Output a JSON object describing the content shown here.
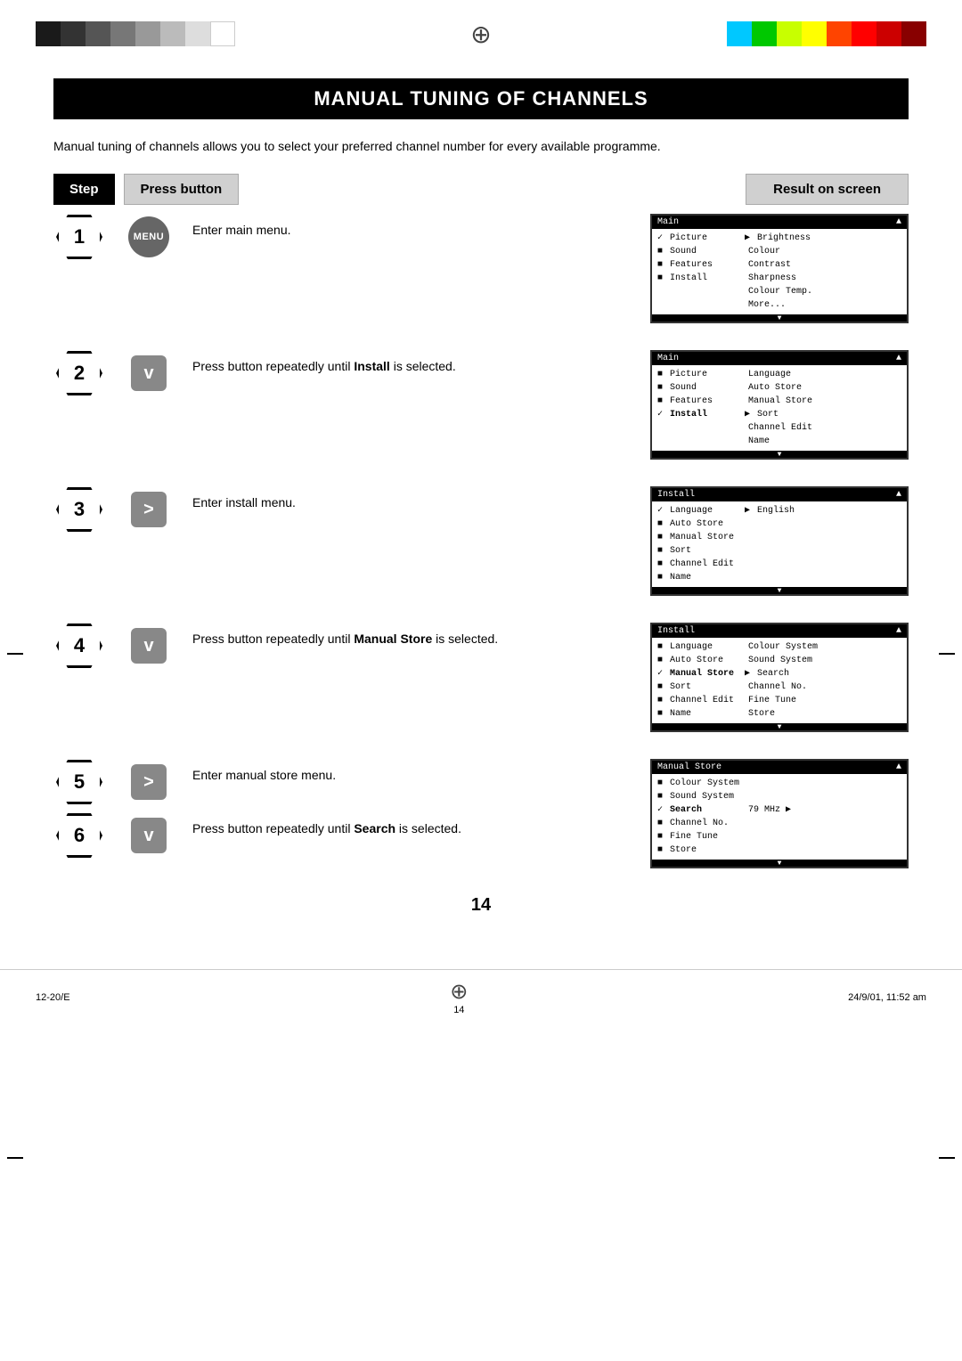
{
  "page": {
    "number": "14",
    "bottom_left": "12-20/E",
    "bottom_center": "14",
    "bottom_right": "24/9/01, 11:52 am"
  },
  "title": "Manual Tuning of Channels",
  "intro": "Manual tuning of channels allows you to select your preferred channel number for every available programme.",
  "header": {
    "step": "Step",
    "press": "Press button",
    "result": "Result on screen"
  },
  "steps": [
    {
      "number": "1",
      "button": "MENU",
      "button_type": "circle",
      "text": "Enter main menu.",
      "bold": "",
      "screen": {
        "title": "Main",
        "has_up": true,
        "lines": [
          {
            "check": true,
            "label": "Picture",
            "arrow": true,
            "value": "Brightness"
          },
          {
            "check": false,
            "label": "Sound",
            "value": "Colour"
          },
          {
            "check": false,
            "label": "Features",
            "value": "Contrast"
          },
          {
            "check": false,
            "label": "Install",
            "value": "Sharpness"
          },
          {
            "check": false,
            "label": "",
            "value": "Colour Temp."
          },
          {
            "check": false,
            "label": "",
            "value": "More..."
          }
        ],
        "has_down": true
      }
    },
    {
      "number": "2",
      "button": "v",
      "button_type": "rect",
      "text": "Press button repeatedly until ",
      "bold": "Install",
      "text2": " is selected.",
      "screen": {
        "title": "Main",
        "has_up": true,
        "lines": [
          {
            "check": false,
            "label": "Picture",
            "arrow": false,
            "value": "Language"
          },
          {
            "check": false,
            "label": "Sound",
            "value": "Auto Store"
          },
          {
            "check": false,
            "label": "Features",
            "value": "Manual Store"
          },
          {
            "check": true,
            "label": "Install",
            "arrow": true,
            "value": "Sort"
          },
          {
            "check": false,
            "label": "",
            "value": "Channel Edit"
          },
          {
            "check": false,
            "label": "",
            "value": "Name"
          }
        ],
        "has_down": true
      }
    },
    {
      "number": "3",
      "button": ">",
      "button_type": "rect",
      "text": "Enter install menu.",
      "bold": "",
      "screen": {
        "title": "Install",
        "has_up": true,
        "lines": [
          {
            "check": true,
            "label": "Language",
            "arrow": true,
            "value": "English"
          },
          {
            "check": false,
            "label": "Auto Store",
            "value": ""
          },
          {
            "check": false,
            "label": "Manual Store",
            "value": ""
          },
          {
            "check": false,
            "label": "Sort",
            "value": ""
          },
          {
            "check": false,
            "label": "Channel Edit",
            "value": ""
          },
          {
            "check": false,
            "label": "Name",
            "value": ""
          }
        ],
        "has_down": true
      }
    },
    {
      "number": "4",
      "button": "v",
      "button_type": "rect",
      "text": "Press button repeatedly until ",
      "bold": "Manual Store",
      "text2": " is selected.",
      "screen": {
        "title": "Install",
        "has_up": true,
        "lines": [
          {
            "check": false,
            "label": "Language",
            "value": "Colour System"
          },
          {
            "check": false,
            "label": "Auto Store",
            "value": "Sound System"
          },
          {
            "check": true,
            "label": "Manual Store",
            "arrow": true,
            "value": "Search"
          },
          {
            "check": false,
            "label": "Sort",
            "value": "Channel No."
          },
          {
            "check": false,
            "label": "Channel Edit",
            "value": "Fine Tune"
          },
          {
            "check": false,
            "label": "Name",
            "value": "Store"
          }
        ],
        "has_down": true
      }
    },
    {
      "number5": "5",
      "number6": "6",
      "button5": ">",
      "button5_type": "rect",
      "text5": "Enter manual store menu.",
      "button6": "v",
      "button6_type": "rect",
      "text6_pre": "Press button repeatedly until ",
      "bold6": "Search",
      "text6_post": " is selected.",
      "screen": {
        "title": "Manual Store",
        "has_up": true,
        "lines": [
          {
            "check": false,
            "label": "Colour System",
            "value": ""
          },
          {
            "check": false,
            "label": "Sound System",
            "value": ""
          },
          {
            "check": true,
            "label": "Search",
            "value": "79 MHz",
            "arrow_right": true
          },
          {
            "check": false,
            "label": "Channel No.",
            "value": ""
          },
          {
            "check": false,
            "label": "Fine Tune",
            "value": ""
          },
          {
            "check": false,
            "label": "Store",
            "value": ""
          }
        ],
        "has_down": true
      }
    }
  ]
}
